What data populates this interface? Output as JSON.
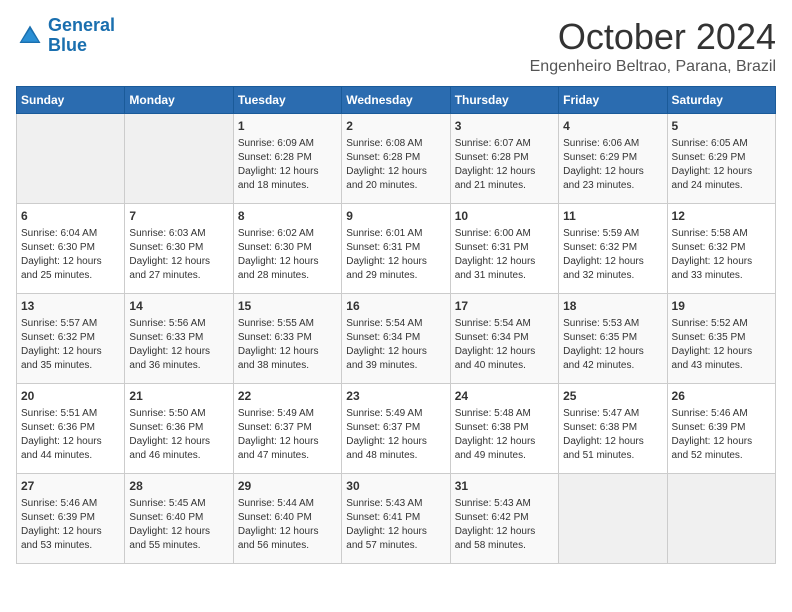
{
  "logo": {
    "line1": "General",
    "line2": "Blue"
  },
  "header": {
    "month": "October 2024",
    "location": "Engenheiro Beltrao, Parana, Brazil"
  },
  "days_of_week": [
    "Sunday",
    "Monday",
    "Tuesday",
    "Wednesday",
    "Thursday",
    "Friday",
    "Saturday"
  ],
  "weeks": [
    [
      {
        "day": "",
        "info": ""
      },
      {
        "day": "",
        "info": ""
      },
      {
        "day": "1",
        "info": "Sunrise: 6:09 AM\nSunset: 6:28 PM\nDaylight: 12 hours and 18 minutes."
      },
      {
        "day": "2",
        "info": "Sunrise: 6:08 AM\nSunset: 6:28 PM\nDaylight: 12 hours and 20 minutes."
      },
      {
        "day": "3",
        "info": "Sunrise: 6:07 AM\nSunset: 6:28 PM\nDaylight: 12 hours and 21 minutes."
      },
      {
        "day": "4",
        "info": "Sunrise: 6:06 AM\nSunset: 6:29 PM\nDaylight: 12 hours and 23 minutes."
      },
      {
        "day": "5",
        "info": "Sunrise: 6:05 AM\nSunset: 6:29 PM\nDaylight: 12 hours and 24 minutes."
      }
    ],
    [
      {
        "day": "6",
        "info": "Sunrise: 6:04 AM\nSunset: 6:30 PM\nDaylight: 12 hours and 25 minutes."
      },
      {
        "day": "7",
        "info": "Sunrise: 6:03 AM\nSunset: 6:30 PM\nDaylight: 12 hours and 27 minutes."
      },
      {
        "day": "8",
        "info": "Sunrise: 6:02 AM\nSunset: 6:30 PM\nDaylight: 12 hours and 28 minutes."
      },
      {
        "day": "9",
        "info": "Sunrise: 6:01 AM\nSunset: 6:31 PM\nDaylight: 12 hours and 29 minutes."
      },
      {
        "day": "10",
        "info": "Sunrise: 6:00 AM\nSunset: 6:31 PM\nDaylight: 12 hours and 31 minutes."
      },
      {
        "day": "11",
        "info": "Sunrise: 5:59 AM\nSunset: 6:32 PM\nDaylight: 12 hours and 32 minutes."
      },
      {
        "day": "12",
        "info": "Sunrise: 5:58 AM\nSunset: 6:32 PM\nDaylight: 12 hours and 33 minutes."
      }
    ],
    [
      {
        "day": "13",
        "info": "Sunrise: 5:57 AM\nSunset: 6:32 PM\nDaylight: 12 hours and 35 minutes."
      },
      {
        "day": "14",
        "info": "Sunrise: 5:56 AM\nSunset: 6:33 PM\nDaylight: 12 hours and 36 minutes."
      },
      {
        "day": "15",
        "info": "Sunrise: 5:55 AM\nSunset: 6:33 PM\nDaylight: 12 hours and 38 minutes."
      },
      {
        "day": "16",
        "info": "Sunrise: 5:54 AM\nSunset: 6:34 PM\nDaylight: 12 hours and 39 minutes."
      },
      {
        "day": "17",
        "info": "Sunrise: 5:54 AM\nSunset: 6:34 PM\nDaylight: 12 hours and 40 minutes."
      },
      {
        "day": "18",
        "info": "Sunrise: 5:53 AM\nSunset: 6:35 PM\nDaylight: 12 hours and 42 minutes."
      },
      {
        "day": "19",
        "info": "Sunrise: 5:52 AM\nSunset: 6:35 PM\nDaylight: 12 hours and 43 minutes."
      }
    ],
    [
      {
        "day": "20",
        "info": "Sunrise: 5:51 AM\nSunset: 6:36 PM\nDaylight: 12 hours and 44 minutes."
      },
      {
        "day": "21",
        "info": "Sunrise: 5:50 AM\nSunset: 6:36 PM\nDaylight: 12 hours and 46 minutes."
      },
      {
        "day": "22",
        "info": "Sunrise: 5:49 AM\nSunset: 6:37 PM\nDaylight: 12 hours and 47 minutes."
      },
      {
        "day": "23",
        "info": "Sunrise: 5:49 AM\nSunset: 6:37 PM\nDaylight: 12 hours and 48 minutes."
      },
      {
        "day": "24",
        "info": "Sunrise: 5:48 AM\nSunset: 6:38 PM\nDaylight: 12 hours and 49 minutes."
      },
      {
        "day": "25",
        "info": "Sunrise: 5:47 AM\nSunset: 6:38 PM\nDaylight: 12 hours and 51 minutes."
      },
      {
        "day": "26",
        "info": "Sunrise: 5:46 AM\nSunset: 6:39 PM\nDaylight: 12 hours and 52 minutes."
      }
    ],
    [
      {
        "day": "27",
        "info": "Sunrise: 5:46 AM\nSunset: 6:39 PM\nDaylight: 12 hours and 53 minutes."
      },
      {
        "day": "28",
        "info": "Sunrise: 5:45 AM\nSunset: 6:40 PM\nDaylight: 12 hours and 55 minutes."
      },
      {
        "day": "29",
        "info": "Sunrise: 5:44 AM\nSunset: 6:40 PM\nDaylight: 12 hours and 56 minutes."
      },
      {
        "day": "30",
        "info": "Sunrise: 5:43 AM\nSunset: 6:41 PM\nDaylight: 12 hours and 57 minutes."
      },
      {
        "day": "31",
        "info": "Sunrise: 5:43 AM\nSunset: 6:42 PM\nDaylight: 12 hours and 58 minutes."
      },
      {
        "day": "",
        "info": ""
      },
      {
        "day": "",
        "info": ""
      }
    ]
  ]
}
